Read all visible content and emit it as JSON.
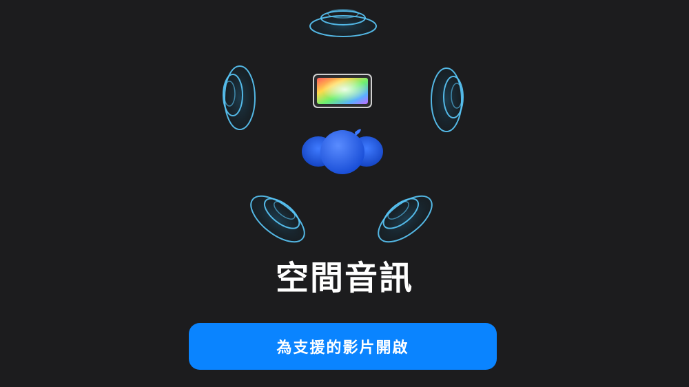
{
  "spatial_audio": {
    "title": "空間音訊",
    "enable_button_label": "為支援的影片開啟"
  },
  "colors": {
    "background": "#1c1c1e",
    "speaker_ring": "#5ac8fa",
    "listener_blue": "#1e63e9",
    "button_blue": "#0a84ff",
    "text": "#ffffff"
  },
  "icons": [
    "speaker-top-icon",
    "speaker-left-icon",
    "speaker-right-icon",
    "speaker-rear-left-icon",
    "speaker-rear-right-icon",
    "tv-screen-icon",
    "listener-head-icon"
  ]
}
